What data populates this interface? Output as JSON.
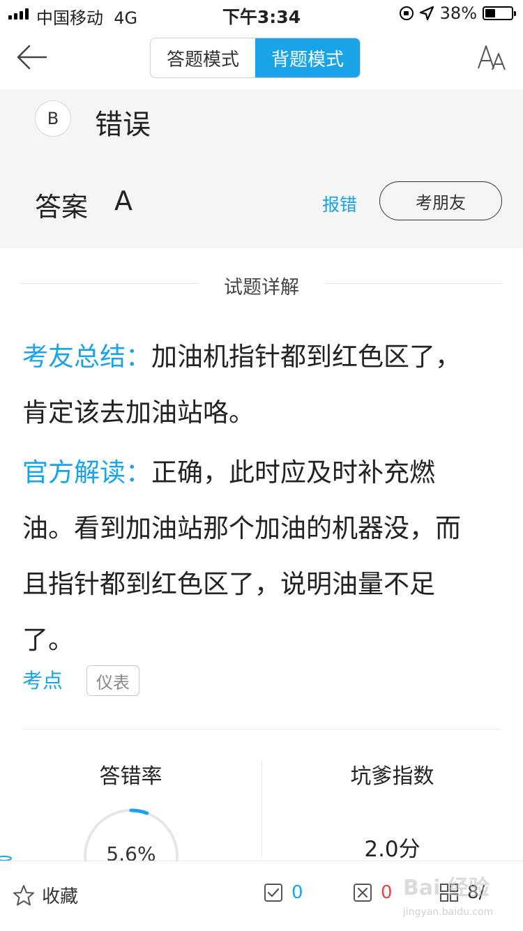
{
  "status_bar": {
    "carrier": "中国移动",
    "network": "4G",
    "time": "下午3:34",
    "battery": "38%"
  },
  "nav": {
    "modes": [
      "答题模式",
      "背题模式"
    ],
    "active_mode_index": 1
  },
  "option": {
    "letter": "B",
    "text": "错误"
  },
  "answer": {
    "label": "答案",
    "value": "A",
    "report_label": "报错",
    "ask_friend_label": "考朋友"
  },
  "section": {
    "title": "试题详解"
  },
  "explanations": [
    {
      "label": "考友总结：",
      "text": "加油机指针都到红色区了，肯定该去加油站咯。"
    },
    {
      "label": "官方解读：",
      "text": "正确，此时应及时补充燃油。看到加油站那个加油的机器没，而且指针都到红色区了，说明油量不足了。"
    }
  ],
  "knowledge_point": {
    "label": "考点",
    "tag": "仪表"
  },
  "stats": {
    "error_rate_title": "答错率",
    "error_rate_value": "5.6%",
    "error_rate_fraction": 0.056,
    "difficulty_title": "坑爹指数",
    "difficulty_value": "2.0分"
  },
  "bottom_bar": {
    "favorite_label": "收藏",
    "correct_count": "0",
    "wrong_count": "0",
    "progress": "8/"
  },
  "watermark": {
    "text": "Bai 经验",
    "sub": "jingyan.baidu.com"
  },
  "colors": {
    "accent": "#19a4ea",
    "wrong": "#e84545",
    "panel_bg": "#f5f5f5"
  }
}
